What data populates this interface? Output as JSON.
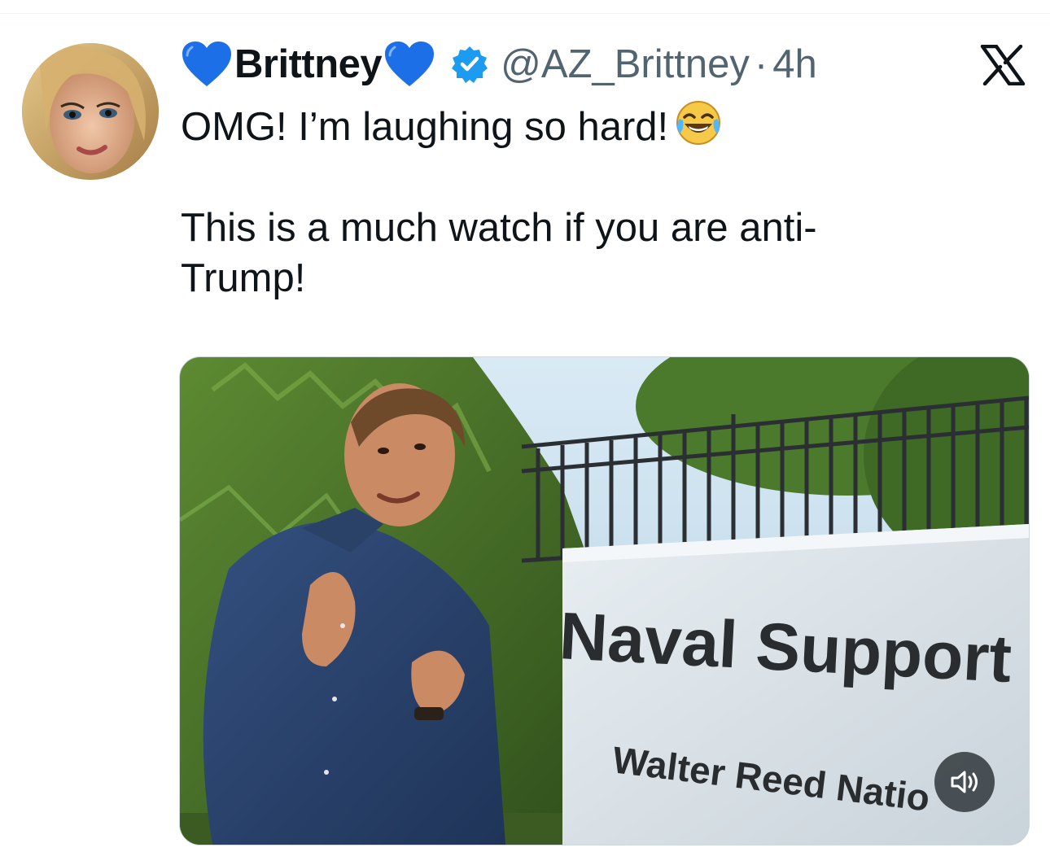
{
  "tweet": {
    "display_name_prefix_icon": "blue-heart-emoji",
    "display_name": "Brittney",
    "display_name_suffix_icon": "blue-heart-emoji",
    "verified_icon": "verified-badge-icon",
    "handle": "@AZ_Brittney",
    "separator": "·",
    "time": "4h",
    "platform_icon": "x-logo-icon",
    "text_line_1": "OMG! I’m laughing so hard!",
    "text_line_1_emoji": "face-with-tears-of-joy-emoji",
    "text_line_2": "This is a much watch if you are anti-",
    "text_line_3": "Trump!"
  },
  "media": {
    "type": "video",
    "sign_line_1": "Naval Support",
    "sign_line_2": "Walter Reed Natio",
    "sound_icon": "speaker-icon"
  },
  "colors": {
    "text_primary": "#0f1419",
    "text_secondary": "#536471",
    "verified_blue": "#1d9bf0",
    "heart_blue": "#1d6fe8",
    "divider": "#eff3f4"
  }
}
